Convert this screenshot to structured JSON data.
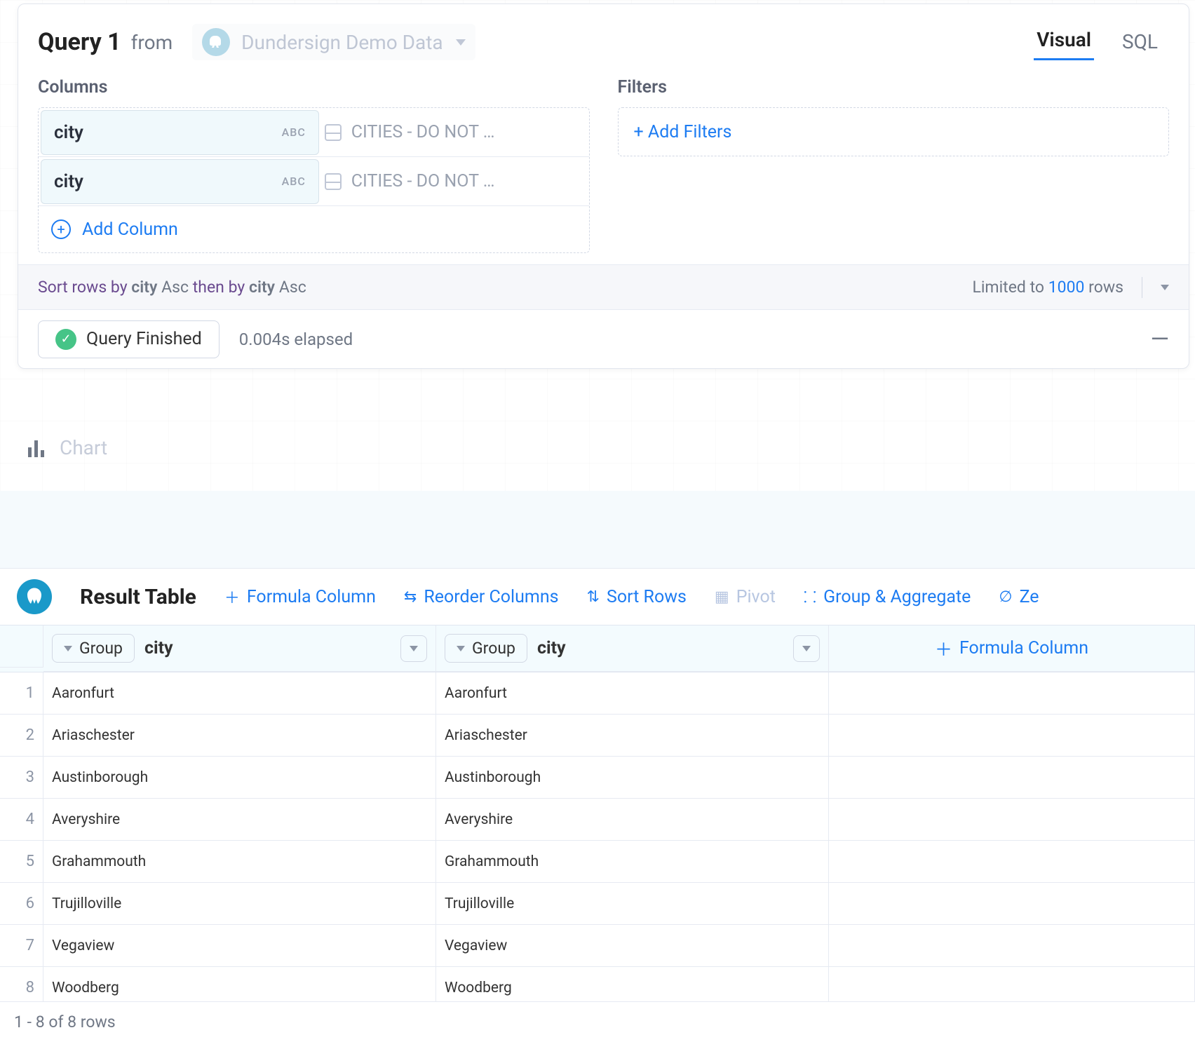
{
  "query": {
    "title": "Query 1",
    "from_label": "from",
    "source_name": "Dundersign Demo Data",
    "tabs": {
      "visual": "Visual",
      "sql": "SQL",
      "active": "visual"
    },
    "columns_heading": "Columns",
    "filters_heading": "Filters",
    "columns": [
      {
        "name": "city",
        "type_badge": "ABC",
        "table_ref": "CITIES - DO NOT …"
      },
      {
        "name": "city",
        "type_badge": "ABC",
        "table_ref": "CITIES - DO NOT …"
      }
    ],
    "add_column_label": "Add Column",
    "add_filters_label": "+ Add Filters",
    "sort": {
      "prefix": "Sort rows by",
      "col1": "city",
      "dir1": "Asc",
      "then": "then by",
      "col2": "city",
      "dir2": "Asc"
    },
    "limit": {
      "prefix": "Limited to",
      "count": "1000",
      "suffix": "rows"
    },
    "status": {
      "label": "Query Finished",
      "elapsed": "0.004s elapsed"
    }
  },
  "chart_label": "Chart",
  "results": {
    "title": "Result Table",
    "tools": {
      "formula": "Formula Column",
      "reorder": "Reorder Columns",
      "sort": "Sort Rows",
      "pivot": "Pivot",
      "group": "Group & Aggregate",
      "ze": "Ze"
    },
    "group_btn": "Group",
    "header_cols": [
      "city",
      "city"
    ],
    "add_formula_header": "Formula Column",
    "rows": [
      [
        "Aaronfurt",
        "Aaronfurt"
      ],
      [
        "Ariaschester",
        "Ariaschester"
      ],
      [
        "Austinborough",
        "Austinborough"
      ],
      [
        "Averyshire",
        "Averyshire"
      ],
      [
        "Grahammouth",
        "Grahammouth"
      ],
      [
        "Trujilloville",
        "Trujilloville"
      ],
      [
        "Vegaview",
        "Vegaview"
      ],
      [
        "Woodberg",
        "Woodberg"
      ]
    ],
    "pager": "1 - 8 of 8 rows"
  }
}
